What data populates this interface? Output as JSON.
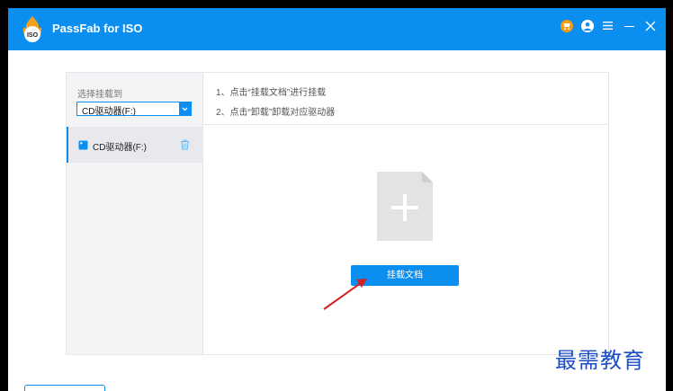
{
  "app": {
    "title": "PassFab for ISO",
    "logo_badge": "ISO"
  },
  "titlebar": {
    "buttons": [
      "cart-icon",
      "user-icon",
      "menu-icon",
      "minimize-icon",
      "close-icon"
    ],
    "accent": "#0a8ff0",
    "cart_color": "#f39c12"
  },
  "sidebar": {
    "mount_label": "选择挂载到",
    "select_value": "CD驱动器(F:)",
    "drives": [
      {
        "label": "CD驱动器(F:)"
      }
    ]
  },
  "instructions": {
    "step1": "1、点击“挂载文档”进行挂载",
    "step2": "2、点击“卸载”卸载对应驱动器"
  },
  "main": {
    "mount_button": "挂载文档"
  },
  "watermark": "最需教育"
}
